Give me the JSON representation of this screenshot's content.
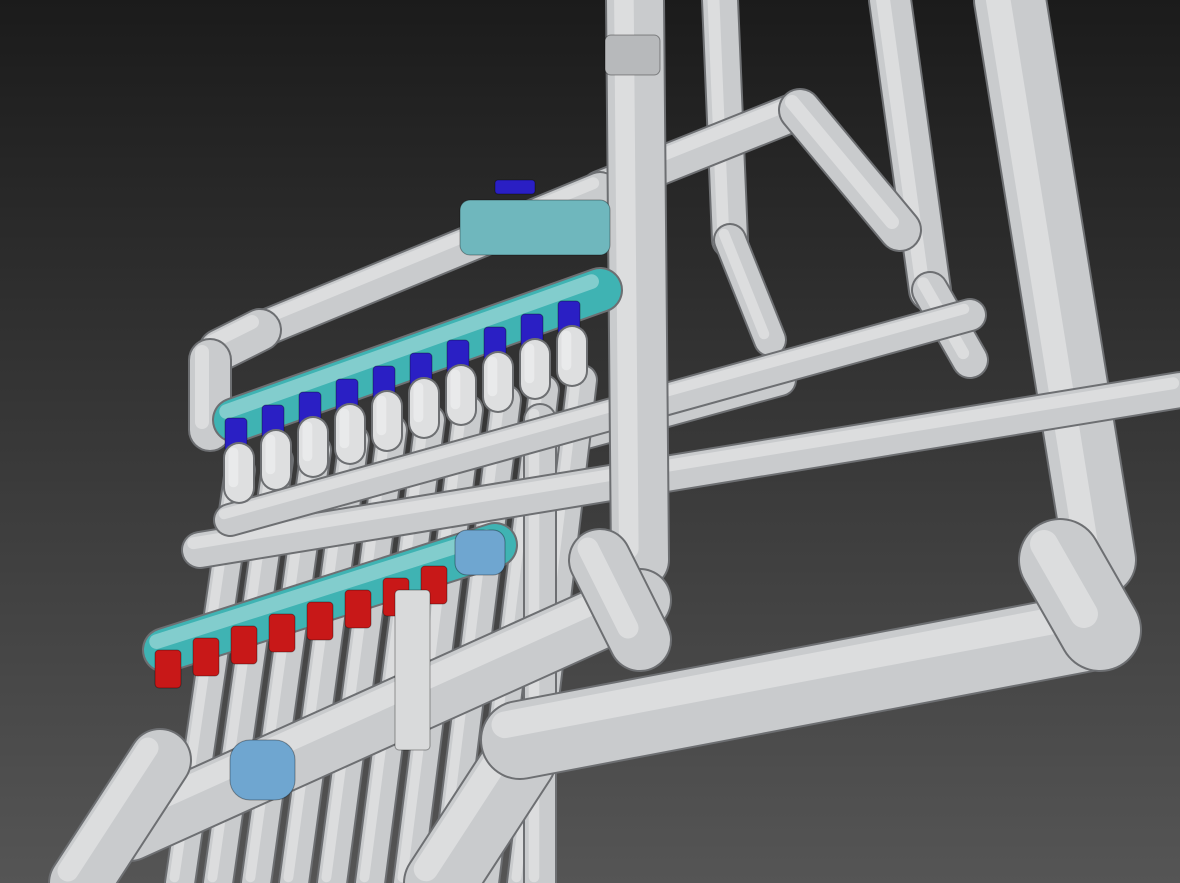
{
  "scene": {
    "background_top": "#1b1b1b",
    "background_bottom": "#555555",
    "pipe_color": "#c9cbcd",
    "manifold_color": "#3fb3b3",
    "supply_handle_color": "#2a1fc4",
    "return_handle_color": "#c81818",
    "supply_valve_count": 10,
    "return_valve_count": 8
  }
}
